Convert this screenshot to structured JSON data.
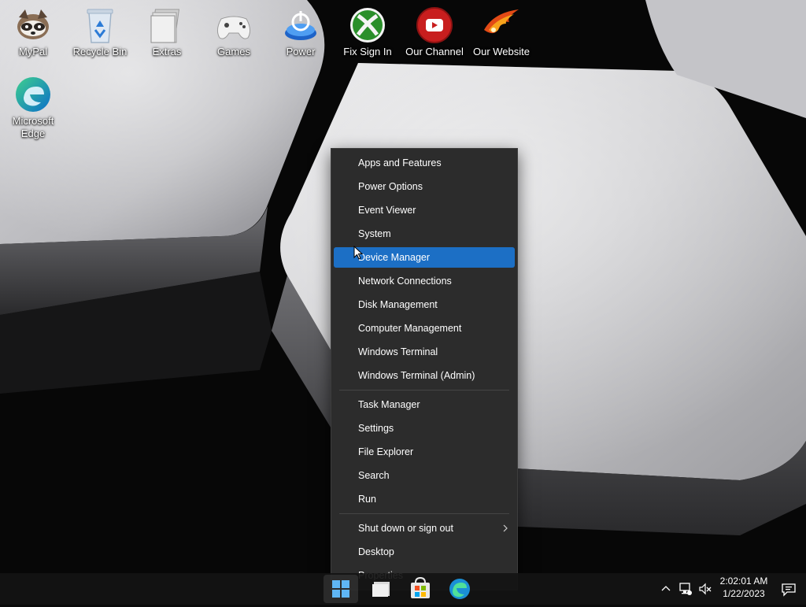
{
  "desktop": {
    "icons": [
      {
        "label": "MyPal",
        "icon": "raccoon-icon"
      },
      {
        "label": "Recycle Bin",
        "icon": "recycle-bin-icon"
      },
      {
        "label": "Extras",
        "icon": "folder-icon"
      },
      {
        "label": "Games",
        "icon": "gamepad-icon"
      },
      {
        "label": "Power",
        "icon": "power-icon"
      },
      {
        "label": "Fix Sign In",
        "icon": "xbox-icon"
      },
      {
        "label": "Our Channel",
        "icon": "youtube-icon"
      },
      {
        "label": "Our Website",
        "icon": "phoenix-icon"
      },
      {
        "label": "Microsoft Edge",
        "icon": "edge-icon"
      }
    ]
  },
  "context_menu": {
    "groups": [
      [
        "Apps and Features",
        "Power Options",
        "Event Viewer",
        "System",
        "Device Manager",
        "Network Connections",
        "Disk Management",
        "Computer Management",
        "Windows Terminal",
        "Windows Terminal (Admin)"
      ],
      [
        "Task Manager",
        "Settings",
        "File Explorer",
        "Search",
        "Run"
      ],
      [
        "Shut down or sign out",
        "Desktop",
        "Properties"
      ]
    ],
    "highlighted": "Device Manager",
    "submenu_item": "Shut down or sign out"
  },
  "taskbar": {
    "buttons": [
      "start-icon",
      "file-explorer-icon",
      "store-icon",
      "edge-icon"
    ],
    "clock": {
      "time": "2:02:01 AM",
      "date": "1/22/2023"
    },
    "tray_icons": [
      "chevron-up-icon",
      "network-icon",
      "volume-muted-icon",
      "notification-icon"
    ]
  },
  "colors": {
    "menu_bg": "#2c2c2c",
    "highlight": "#1c6fc5",
    "taskbar_bg": "#141414"
  }
}
